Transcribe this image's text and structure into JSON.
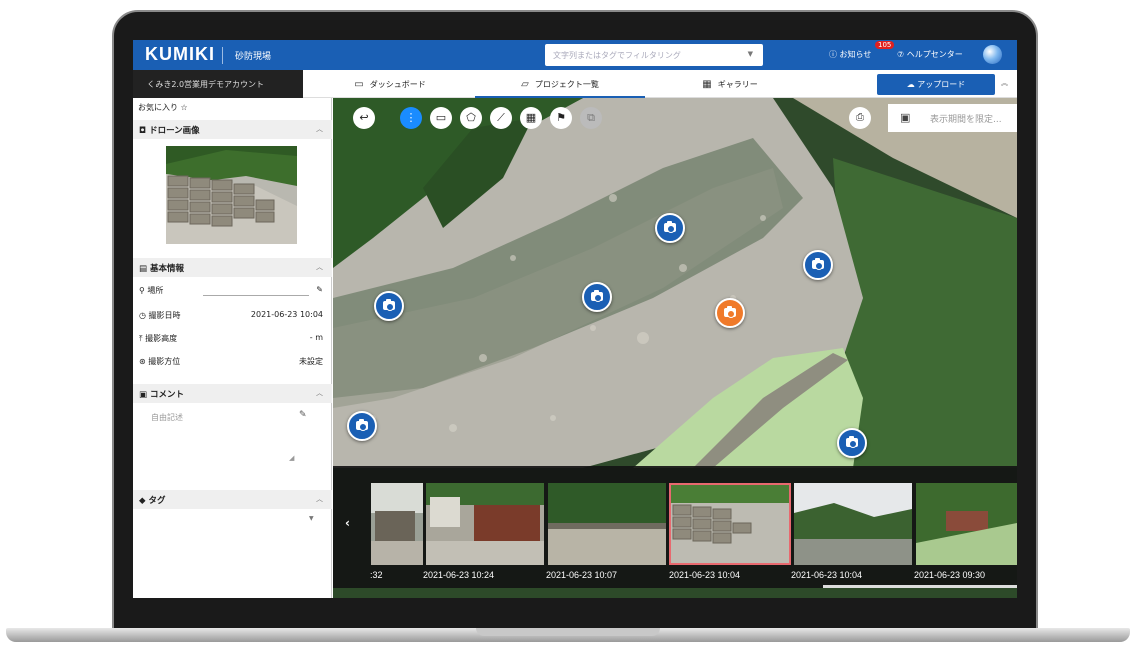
{
  "header": {
    "logo": "KUMIKI",
    "site_name": "砂防現場",
    "filter_placeholder": "文字列またはタグでフィルタリング",
    "notice_label": "お知らせ",
    "notice_count": "105",
    "help_label": "ヘルプセンター",
    "brand_color": "#1a5fb4"
  },
  "nav": {
    "account": "くみき2.0営業用デモアカウント",
    "tabs": [
      {
        "label": "ダッシュボード",
        "icon": "monitor-icon"
      },
      {
        "label": "プロジェクト一覧",
        "icon": "folder-icon",
        "active": true
      },
      {
        "label": "ギャラリー",
        "icon": "grid-icon"
      }
    ],
    "upload_label": "アップロード"
  },
  "sidebar": {
    "favorite_label": "お気に入り",
    "drone_section": "ドローン画像",
    "info_section": "基本情報",
    "fields": [
      {
        "label": "場所",
        "value": ""
      },
      {
        "label": "撮影日時",
        "value": "2021-06-23 10:04"
      },
      {
        "label": "撮影高度",
        "value": "- m"
      },
      {
        "label": "撮影方位",
        "value": "未設定"
      }
    ],
    "comment_section": "コメント",
    "comment_placeholder": "自由記述",
    "tag_section": "タグ"
  },
  "map": {
    "period_placeholder": "表示期間を限定...",
    "pins_total": 7,
    "selected_pin_color": "#f07a2a"
  },
  "filmstrip": {
    "captions": [
      ":32",
      "2021-06-23 10:24",
      "2021-06-23 10:07",
      "2021-06-23 10:04",
      "2021-06-23 10:04",
      "2021-06-23 09:30"
    ],
    "selected_index": 3,
    "selected_color": "#e8696f"
  }
}
